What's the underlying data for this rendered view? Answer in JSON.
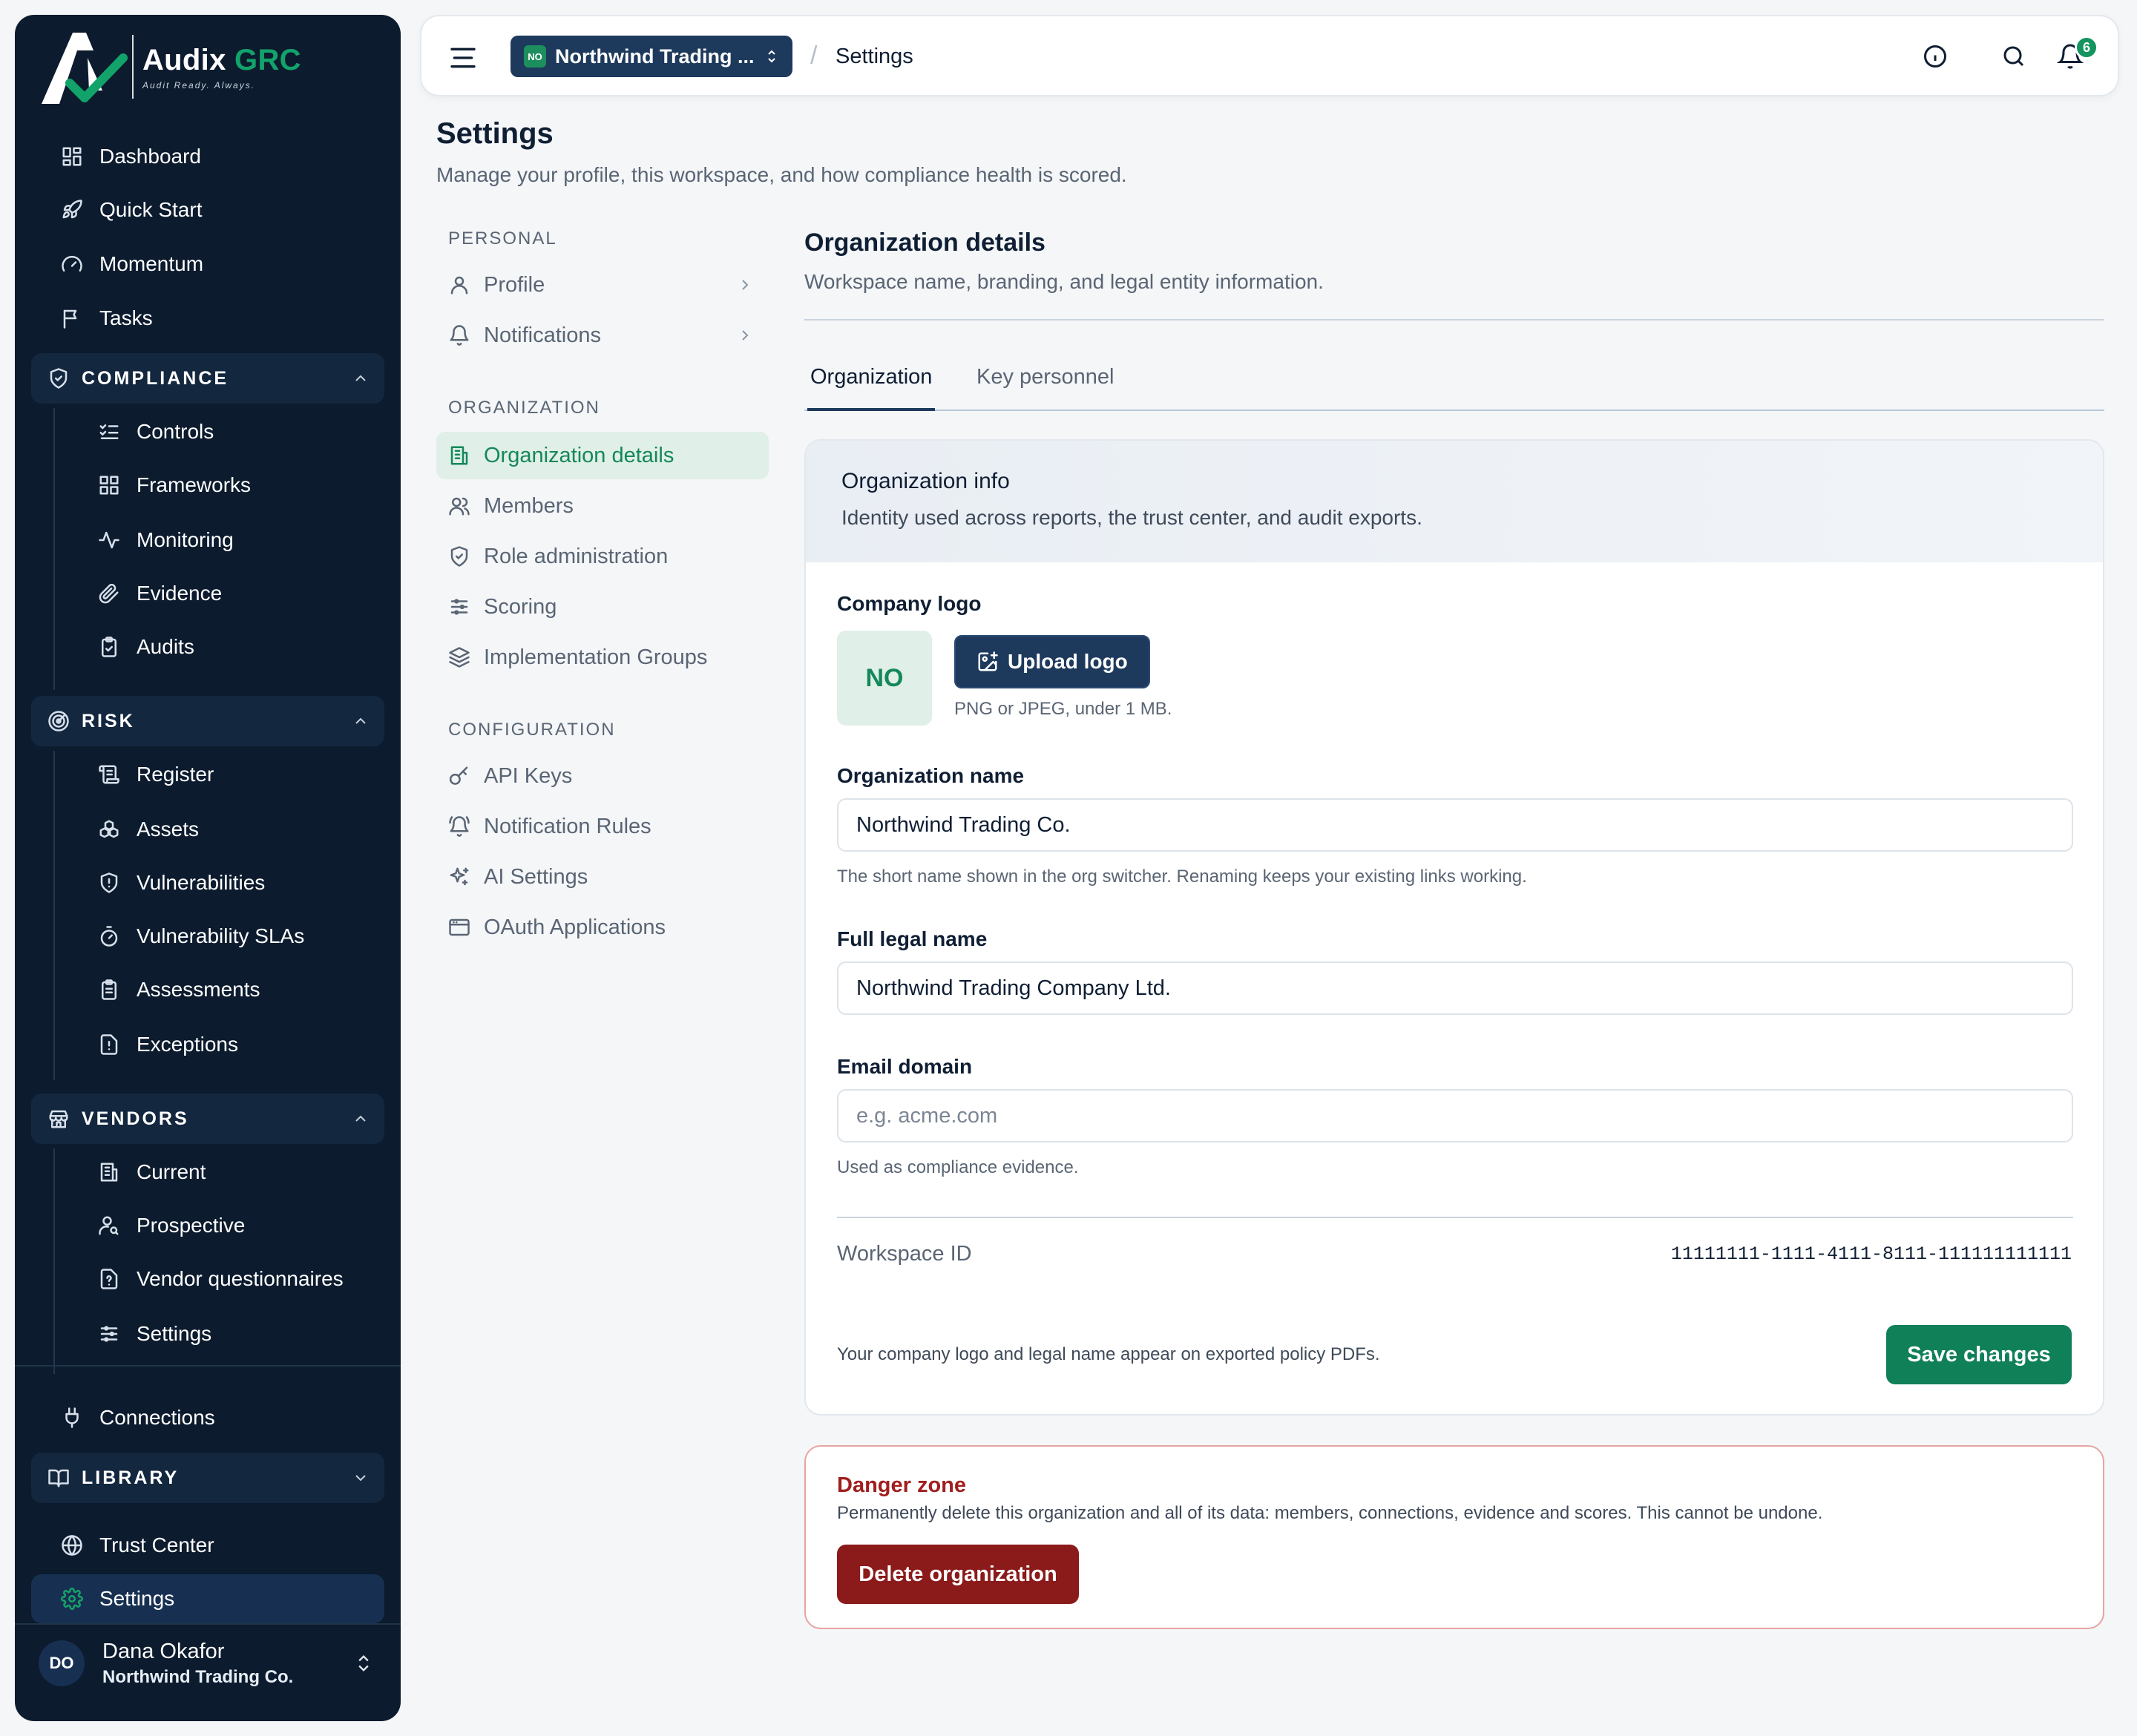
{
  "brand": {
    "name": "Audix",
    "name_accent": "GRC",
    "tagline": "Audit Ready. Always."
  },
  "sidebar": {
    "top_items": [
      {
        "label": "Dashboard",
        "icon": "dashboard-icon"
      },
      {
        "label": "Quick Start",
        "icon": "rocket-icon"
      },
      {
        "label": "Momentum",
        "icon": "gauge-icon"
      },
      {
        "label": "Tasks",
        "icon": "flag-icon"
      }
    ],
    "compliance": {
      "label": "COMPLIANCE",
      "items": [
        "Controls",
        "Frameworks",
        "Monitoring",
        "Evidence",
        "Audits"
      ]
    },
    "risk": {
      "label": "RISK",
      "items": [
        "Register",
        "Assets",
        "Vulnerabilities",
        "Vulnerability SLAs",
        "Assessments",
        "Exceptions"
      ]
    },
    "vendors": {
      "label": "VENDORS",
      "items": [
        "Current",
        "Prospective",
        "Vendor questionnaires",
        "Settings"
      ]
    },
    "connections": "Connections",
    "library": {
      "label": "LIBRARY"
    },
    "trust_center": "Trust Center",
    "settings": "Settings",
    "user": {
      "initials": "DO",
      "name": "Dana Okafor",
      "org": "Northwind Trading Co."
    }
  },
  "topbar": {
    "org_badge": "NO",
    "org_name": "Northwind Trading ...",
    "breadcrumb_sep": "/",
    "breadcrumb_page": "Settings",
    "notification_count": "6"
  },
  "page": {
    "title": "Settings",
    "subtitle": "Manage your profile, this workspace, and how compliance health is scored."
  },
  "settings_nav": {
    "personal_heading": "PERSONAL",
    "personal": [
      "Profile",
      "Notifications"
    ],
    "organization_heading": "ORGANIZATION",
    "organization": [
      "Organization details",
      "Members",
      "Role administration",
      "Scoring",
      "Implementation Groups"
    ],
    "configuration_heading": "CONFIGURATION",
    "configuration": [
      "API Keys",
      "Notification Rules",
      "AI Settings",
      "OAuth Applications"
    ]
  },
  "section": {
    "title": "Organization details",
    "subtitle": "Workspace name, branding, and legal entity information.",
    "tabs": [
      "Organization",
      "Key personnel"
    ]
  },
  "card": {
    "title": "Organization info",
    "subtitle": "Identity used across reports, the trust center, and audit exports.",
    "logo_label": "Company logo",
    "logo_initials": "NO",
    "upload_label": "Upload logo",
    "logo_hint": "PNG or JPEG, under 1 MB.",
    "org_name_label": "Organization name",
    "org_name_value": "Northwind Trading Co.",
    "org_name_hint": "The short name shown in the org switcher. Renaming keeps your existing links working.",
    "legal_label": "Full legal name",
    "legal_value": "Northwind Trading Company Ltd.",
    "email_label": "Email domain",
    "email_placeholder": "e.g. acme.com",
    "email_hint": "Used as compliance evidence.",
    "workspace_label": "Workspace ID",
    "workspace_id": "11111111-1111-4111-8111-111111111111",
    "footer_note": "Your company logo and legal name appear on exported policy PDFs.",
    "save_label": "Save changes"
  },
  "danger": {
    "title": "Danger zone",
    "text": "Permanently delete this organization and all of its data: members, connections, evidence and scores. This cannot be undone.",
    "button": "Delete organization"
  },
  "colors": {
    "sidebar_bg": "#0c1b2e",
    "accent_green": "#108059",
    "navy_button": "#1d3a5d",
    "danger_red": "#8b1a1a"
  }
}
